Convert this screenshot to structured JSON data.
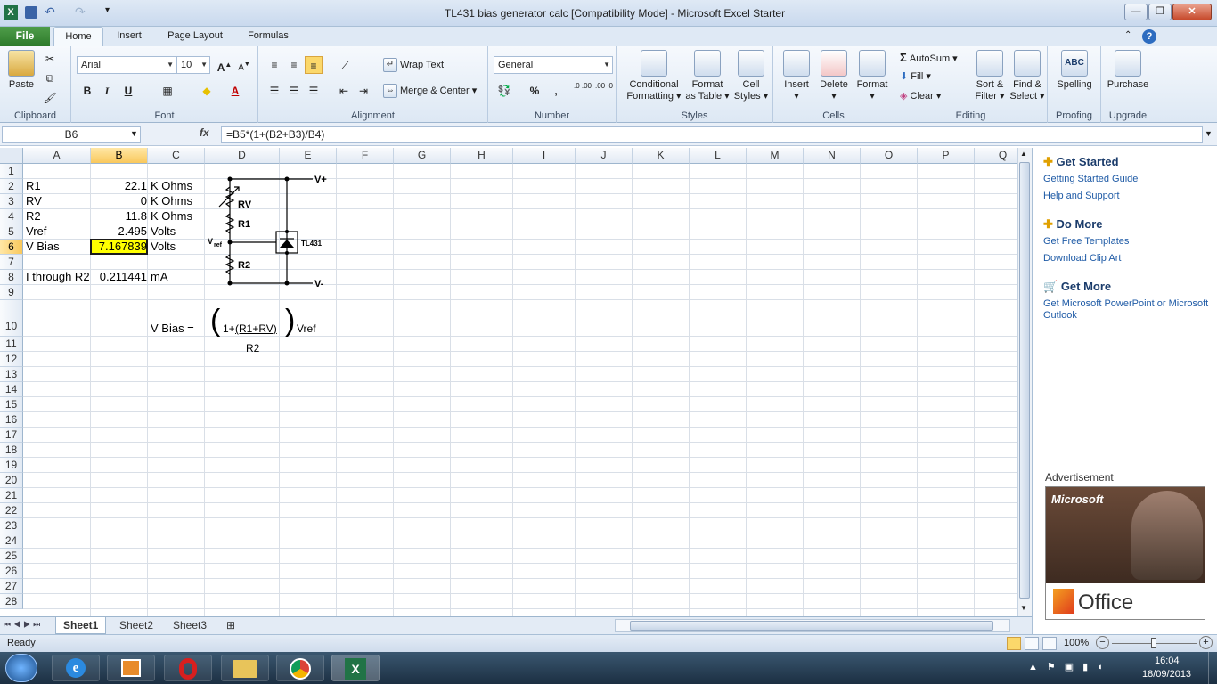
{
  "window": {
    "title": "TL431 bias generator calc  [Compatibility Mode]  -  Microsoft Excel Starter"
  },
  "ribbon_tabs": [
    "File",
    "Home",
    "Insert",
    "Page Layout",
    "Formulas"
  ],
  "ribbon": {
    "clipboard": {
      "paste": "Paste",
      "label": "Clipboard"
    },
    "font": {
      "name": "Arial",
      "size": "10",
      "label": "Font",
      "bold": "B",
      "italic": "I",
      "underline": "U"
    },
    "alignment": {
      "wrap_text": "Wrap Text",
      "merge_center": "Merge & Center",
      "label": "Alignment"
    },
    "number": {
      "format": "General",
      "label": "Number",
      "percent": "%",
      "comma": ",",
      "inc_decimal": ".0 .00",
      "dec_decimal": ".00 .0"
    },
    "styles": {
      "conditional_line1": "Conditional",
      "conditional_line2": "Formatting",
      "format_table_line1": "Format",
      "format_table_line2": "as Table",
      "cell_styles_line1": "Cell",
      "cell_styles_line2": "Styles",
      "label": "Styles"
    },
    "cells": {
      "insert": "Insert",
      "delete": "Delete",
      "format": "Format",
      "label": "Cells"
    },
    "editing": {
      "autosum": "AutoSum",
      "fill": "Fill",
      "clear": "Clear",
      "sort_line1": "Sort &",
      "sort_line2": "Filter",
      "find_line1": "Find &",
      "find_line2": "Select",
      "label": "Editing"
    },
    "proofing": {
      "spelling": "Spelling",
      "label": "Proofing",
      "icon_text": "ABC"
    },
    "upgrade": {
      "purchase": "Purchase",
      "label": "Upgrade"
    }
  },
  "formula_bar": {
    "name_box": "B6",
    "fx": "fx",
    "formula": "=B5*(1+(B2+B3)/B4)"
  },
  "columns": [
    "A",
    "B",
    "C",
    "D",
    "E",
    "F",
    "G",
    "H",
    "I",
    "J",
    "K",
    "L",
    "M",
    "N",
    "O",
    "P",
    "Q"
  ],
  "rows": [
    "1",
    "2",
    "3",
    "4",
    "5",
    "6",
    "7",
    "8",
    "9",
    "10",
    "11",
    "12",
    "13",
    "14",
    "15",
    "16",
    "17",
    "18",
    "19",
    "20",
    "21",
    "22",
    "23",
    "24",
    "25",
    "26",
    "27",
    "28"
  ],
  "cells": {
    "A2": "R1",
    "B2": "22.1",
    "C2": "K Ohms",
    "A3": "RV",
    "B3": "0",
    "C3": "K Ohms",
    "A4": "R2",
    "B4": "11.8",
    "C4": "K Ohms",
    "A5": "Vref",
    "B5": "2.495",
    "C5": "Volts",
    "A6": "V Bias",
    "B6": "7.167839",
    "C6": "Volts",
    "A8": "I through R2",
    "B8": "0.211441",
    "C8": "mA",
    "C10": "V Bias ="
  },
  "equation": {
    "open": "(",
    "numerator_prefix": "1+",
    "numerator": "(R1+RV)",
    "close": ")",
    "suffix": "Vref",
    "denominator": "R2"
  },
  "circuit": {
    "vplus": "V+",
    "vminus": "V-",
    "rv": "RV",
    "r1": "R1",
    "r2": "R2",
    "vref": "V",
    "vref_sub": "ref",
    "chip": "TL431"
  },
  "sheet_tabs": [
    "Sheet1",
    "Sheet2",
    "Sheet3"
  ],
  "status": {
    "ready": "Ready",
    "zoom": "100%"
  },
  "pane": {
    "get_started": "Get Started",
    "get_started_links": [
      "Getting Started Guide",
      "Help and Support"
    ],
    "do_more": "Do More",
    "do_more_links": [
      "Get Free Templates",
      "Download Clip Art"
    ],
    "get_more": "Get More",
    "get_more_link": "Get Microsoft PowerPoint or Microsoft Outlook",
    "advertisement": "Advertisement",
    "ad_brand": "Microsoft",
    "ad_product": "Office"
  },
  "taskbar": {
    "time": "16:04",
    "date": "18/09/2013"
  },
  "colors": {
    "selected_cell": "#ffff00",
    "file_tab": "#2d7a2a",
    "link": "#1f5ba6"
  }
}
